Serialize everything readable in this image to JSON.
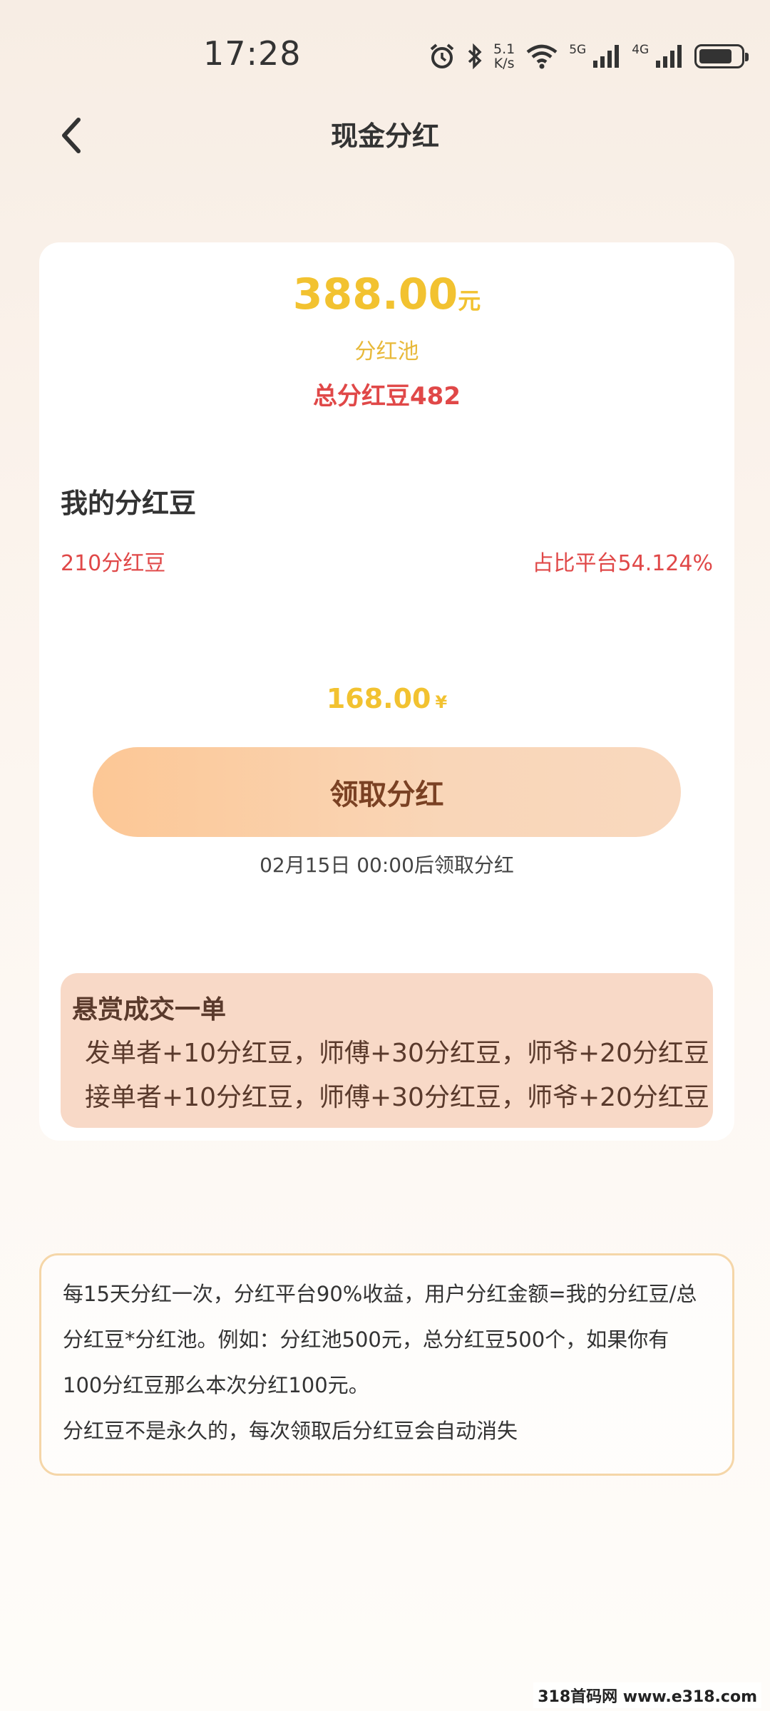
{
  "status_bar": {
    "time": "17:28",
    "net_speed_value": "5.1",
    "net_speed_unit": "K/s",
    "net_5g": "5G",
    "net_4g": "4G",
    "battery_level": 0.8
  },
  "header": {
    "title": "现金分红"
  },
  "pool": {
    "amount": "388.00",
    "unit": "元",
    "label": "分红池",
    "total_beans": "总分红豆482"
  },
  "mine": {
    "title": "我的分红豆",
    "beans": "210分红豆",
    "ratio": "占比平台54.124%",
    "amount": "168.00",
    "currency": "¥",
    "claim_label": "领取分红",
    "claim_note": "02月15日 00:00后领取分红"
  },
  "reward": {
    "title": "悬赏成交一单",
    "lines": [
      "发单者+10分红豆，师傅+30分红豆，师爷+20分红豆",
      "接单者+10分红豆，师傅+30分红豆，师爷+20分红豆"
    ]
  },
  "rules": {
    "lines": [
      "每15天分红一次，分红平台90%收益，用户分红金额=我的分红豆/总",
      "分红豆*分红池。例如：分红池500元，总分红豆500个，如果你有",
      "100分红豆那么本次分红100元。",
      "分红豆不是永久的，每次领取后分红豆会自动消失"
    ]
  },
  "watermark": "318首码网 www.e318.com",
  "colors": {
    "gold": "#f2c230",
    "red": "#e04848",
    "button_start": "#fcc795",
    "button_end": "#f9d8be",
    "button_text": "#7a4123",
    "reward_bg": "#f8d9c7",
    "rules_border": "#f5d6a8"
  },
  "icons": [
    "back-chevron-icon",
    "alarm-icon",
    "bluetooth-icon",
    "wifi-icon",
    "signal-icon",
    "battery-icon"
  ]
}
